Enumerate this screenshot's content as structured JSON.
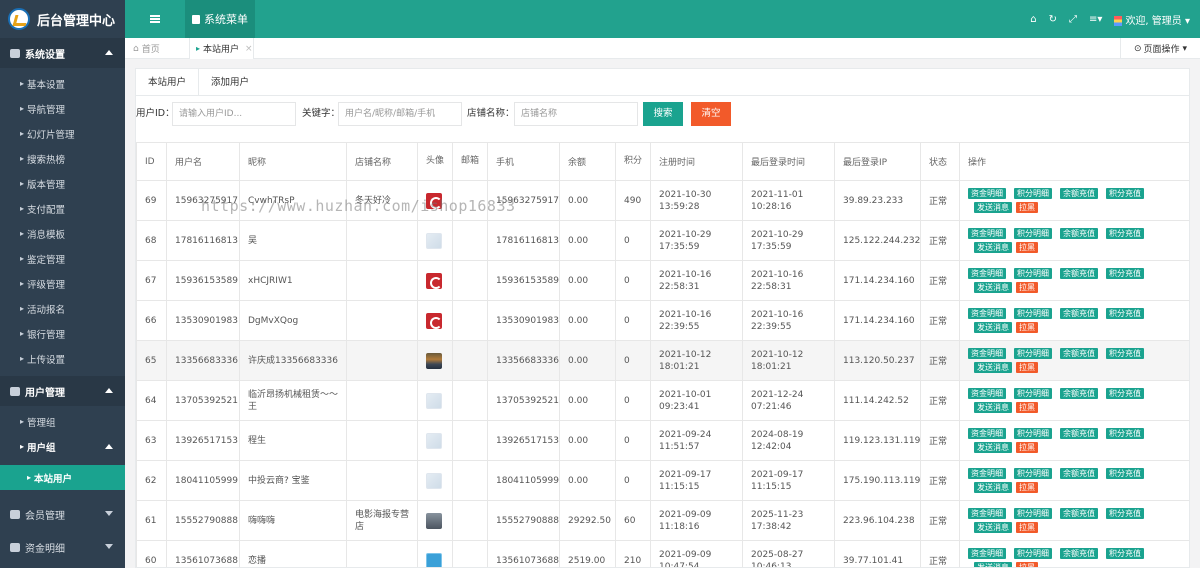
{
  "app": {
    "title": "后台管理中心"
  },
  "topbar": {
    "system_menu": "系统菜单",
    "user_greeting": "欢迎, 管理员",
    "icons": [
      "home-icon",
      "refresh-icon",
      "fullscreen-icon",
      "list-icon",
      "user-icon"
    ]
  },
  "sidebar": {
    "system_settings": {
      "label": "系统设置",
      "items": [
        "基本设置",
        "导航管理",
        "幻灯片管理",
        "搜索热榜",
        "版本管理",
        "支付配置",
        "消息模板",
        "鉴定管理",
        "评级管理",
        "活动报名",
        "银行管理",
        "上传设置"
      ]
    },
    "user_mgmt": {
      "label": "用户管理",
      "items": [
        "管理组",
        "用户组"
      ],
      "active_item": "本站用户"
    },
    "member_mgmt": "会员管理",
    "fund_detail": "资金明细"
  },
  "tabs": {
    "home": "首页",
    "current": "本站用户",
    "page_ops": "页面操作"
  },
  "subtabs": [
    "本站用户",
    "添加用户"
  ],
  "filter": {
    "uid_label": "用户ID：",
    "uid_placeholder": "请输入用户ID...",
    "keyword_label": "关键字：",
    "keyword_placeholder": "用户名/昵称/邮箱/手机",
    "shop_label": "店铺名称：",
    "shop_placeholder": "店铺名称",
    "search_btn": "搜索",
    "clear_btn": "清空"
  },
  "table": {
    "headers": [
      "ID",
      "用户名",
      "昵称",
      "店铺名称",
      "头像",
      "邮箱",
      "手机",
      "余额",
      "积分",
      "注册时间",
      "最后登录时间",
      "最后登录IP",
      "状态",
      "操作"
    ],
    "actions": [
      "资金明细",
      "积分明细",
      "余额充值",
      "积分充值",
      "发送消息",
      "拉黑"
    ],
    "rows": [
      {
        "id": "69",
        "username": "15963275917",
        "nickname": "CvwhTRsP",
        "shop": "冬天好冷",
        "avatar": "red",
        "email": "",
        "phone": "15963275917",
        "balance": "0.00",
        "points": "490",
        "reg_date": "2021-10-30",
        "reg_time": "13:59:28",
        "login_date": "2021-11-01",
        "login_time": "10:28:16",
        "ip": "39.89.23.233",
        "status": "正常"
      },
      {
        "id": "68",
        "username": "17816116813",
        "nickname": "吴",
        "shop": "",
        "avatar": "blank",
        "email": "",
        "phone": "17816116813",
        "balance": "0.00",
        "points": "0",
        "reg_date": "2021-10-29",
        "reg_time": "17:35:59",
        "login_date": "2021-10-29",
        "login_time": "17:35:59",
        "ip": "125.122.244.232",
        "status": "正常"
      },
      {
        "id": "67",
        "username": "15936153589",
        "nickname": "xHCJRIW1",
        "shop": "",
        "avatar": "red",
        "email": "",
        "phone": "15936153589",
        "balance": "0.00",
        "points": "0",
        "reg_date": "2021-10-16",
        "reg_time": "22:58:31",
        "login_date": "2021-10-16",
        "login_time": "22:58:31",
        "ip": "171.14.234.160",
        "status": "正常"
      },
      {
        "id": "66",
        "username": "13530901983",
        "nickname": "DgMvXQog",
        "shop": "",
        "avatar": "red",
        "email": "",
        "phone": "13530901983",
        "balance": "0.00",
        "points": "0",
        "reg_date": "2021-10-16",
        "reg_time": "22:39:55",
        "login_date": "2021-10-16",
        "login_time": "22:39:55",
        "ip": "171.14.234.160",
        "status": "正常"
      },
      {
        "id": "65",
        "username": "13356683336",
        "nickname": "许庆成13356683336",
        "shop": "",
        "avatar": "photo",
        "email": "",
        "phone": "13356683336",
        "balance": "0.00",
        "points": "0",
        "reg_date": "2021-10-12",
        "reg_time": "18:01:21",
        "login_date": "2021-10-12",
        "login_time": "18:01:21",
        "ip": "113.120.50.237",
        "status": "正常"
      },
      {
        "id": "64",
        "username": "13705392521",
        "nickname": "临沂昂扬机械租赁～～王",
        "shop": "",
        "avatar": "blank",
        "email": "",
        "phone": "13705392521",
        "balance": "0.00",
        "points": "0",
        "reg_date": "2021-10-01",
        "reg_time": "09:23:41",
        "login_date": "2021-12-24",
        "login_time": "07:21:46",
        "ip": "111.14.242.52",
        "status": "正常"
      },
      {
        "id": "63",
        "username": "13926517153",
        "nickname": "程生",
        "shop": "",
        "avatar": "blank",
        "email": "",
        "phone": "13926517153",
        "balance": "0.00",
        "points": "0",
        "reg_date": "2021-09-24",
        "reg_time": "11:51:57",
        "login_date": "2024-08-19",
        "login_time": "12:42:04",
        "ip": "119.123.131.119",
        "status": "正常"
      },
      {
        "id": "62",
        "username": "18041105999",
        "nickname": "中投云商? 宝鉴",
        "shop": "",
        "avatar": "blank",
        "email": "",
        "phone": "18041105999",
        "balance": "0.00",
        "points": "0",
        "reg_date": "2021-09-17",
        "reg_time": "11:15:15",
        "login_date": "2021-09-17",
        "login_time": "11:15:15",
        "ip": "175.190.113.119",
        "status": "正常"
      },
      {
        "id": "61",
        "username": "15552790888",
        "nickname": "嗨嗨嗨",
        "shop": "电影海报专营店",
        "avatar": "gray",
        "email": "",
        "phone": "15552790888",
        "balance": "29292.50",
        "points": "60",
        "reg_date": "2021-09-09",
        "reg_time": "11:18:16",
        "login_date": "2025-11-23",
        "login_time": "17:38:42",
        "ip": "223.96.104.238",
        "status": "正常"
      },
      {
        "id": "60",
        "username": "13561073688",
        "nickname": "恋播",
        "shop": "",
        "avatar": "blue",
        "email": "",
        "phone": "13561073688",
        "balance": "2519.00",
        "points": "210",
        "reg_date": "2021-09-09",
        "reg_time": "10:47:54",
        "login_date": "2025-08-27",
        "login_time": "10:46:13",
        "ip": "39.77.101.41",
        "status": "正常"
      }
    ]
  },
  "watermark": "https://www.huzhan.com/ishop16833"
}
